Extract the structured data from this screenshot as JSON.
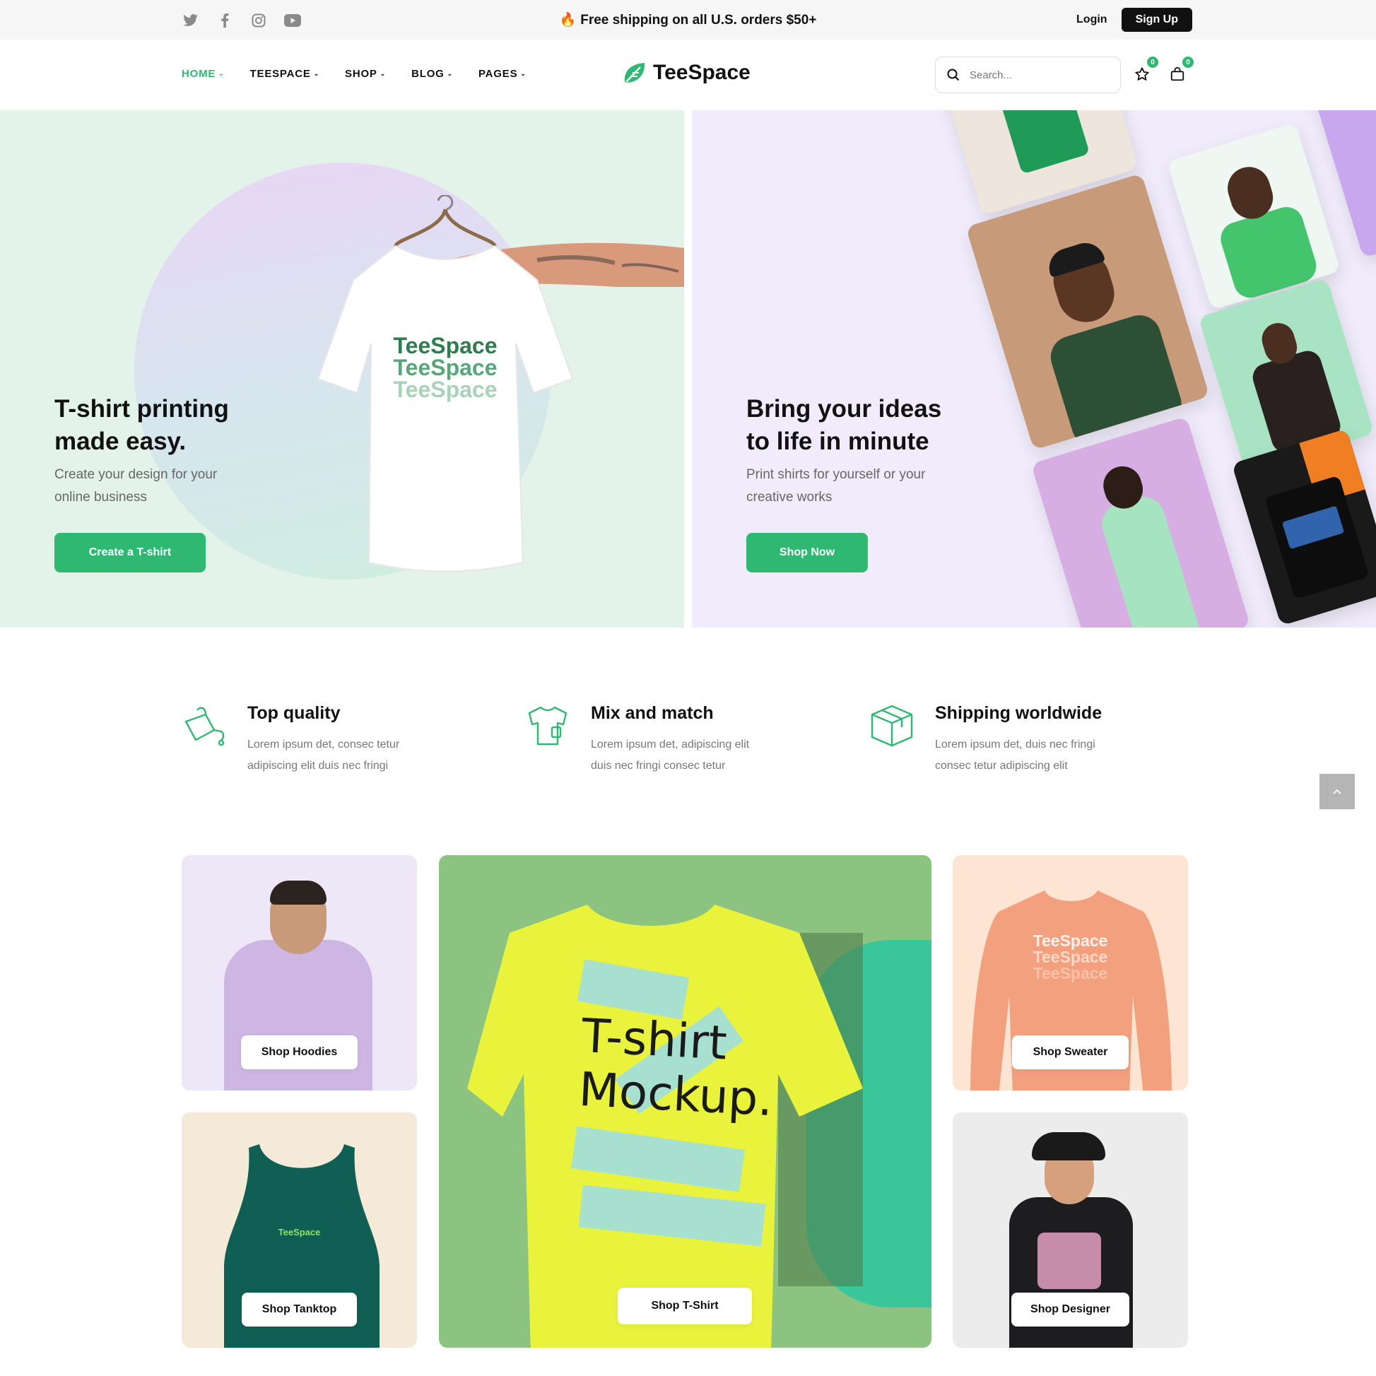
{
  "topbar": {
    "social": [
      {
        "name": "twitter-icon"
      },
      {
        "name": "facebook-icon"
      },
      {
        "name": "instagram-icon"
      },
      {
        "name": "youtube-icon"
      }
    ],
    "promo_icon": "🔥",
    "promo": "Free shipping on all U.S. orders $50+",
    "login": "Login",
    "signup": "Sign Up"
  },
  "nav": {
    "menu": [
      {
        "label": "HOME",
        "active": true
      },
      {
        "label": "TEESPACE",
        "active": false
      },
      {
        "label": "SHOP",
        "active": false
      },
      {
        "label": "BLOG",
        "active": false
      },
      {
        "label": "PAGES",
        "active": false
      }
    ],
    "chevron": "⌄",
    "brand": "TeeSpace",
    "search_placeholder": "Search...",
    "wishlist_count": "0",
    "cart_count": "0"
  },
  "hero": {
    "left": {
      "title_line1": "T-shirt printing",
      "title_line2": "made easy.",
      "subtitle_line1": "Create your design for your",
      "subtitle_line2": "online business",
      "cta": "Create a T-shirt",
      "tee_print": [
        "TeeSpace",
        "TeeSpace",
        "TeeSpace"
      ]
    },
    "right": {
      "title_line1": "Bring your ideas",
      "title_line2": "to life in minute",
      "subtitle_line1": "Print shirts for yourself or your",
      "subtitle_line2": "creative works",
      "cta": "Shop Now"
    }
  },
  "features": [
    {
      "icon": "paint-bucket-icon",
      "title": "Top quality",
      "text_line1": "Lorem ipsum det, consec tetur",
      "text_line2": "adipiscing elit duis nec fringi"
    },
    {
      "icon": "tshirt-icon",
      "title": "Mix and match",
      "text_line1": "Lorem ipsum det, adipiscing elit",
      "text_line2": "duis nec fringi consec tetur"
    },
    {
      "icon": "box-icon",
      "title": "Shipping worldwide",
      "text_line1": "Lorem ipsum det, duis nec fringi",
      "text_line2": "consec tetur adipiscing elit"
    }
  ],
  "categories": {
    "hoodies": "Shop Hoodies",
    "tanktop": "Shop Tanktop",
    "tshirt": "Shop T-Shirt",
    "sweater": "Shop Sweater",
    "designer": "Shop Designer",
    "mockup_line1": "T-shirt",
    "mockup_line2": "Mockup.",
    "sweater_print": [
      "TeeSpace",
      "TeeSpace",
      "TeeSpace"
    ],
    "tank_print": "TeeSpace"
  },
  "colors": {
    "accent": "#2eb872",
    "hero_left_bg": "#e3f3ea",
    "hero_right_bg": "#f1ecfb"
  }
}
